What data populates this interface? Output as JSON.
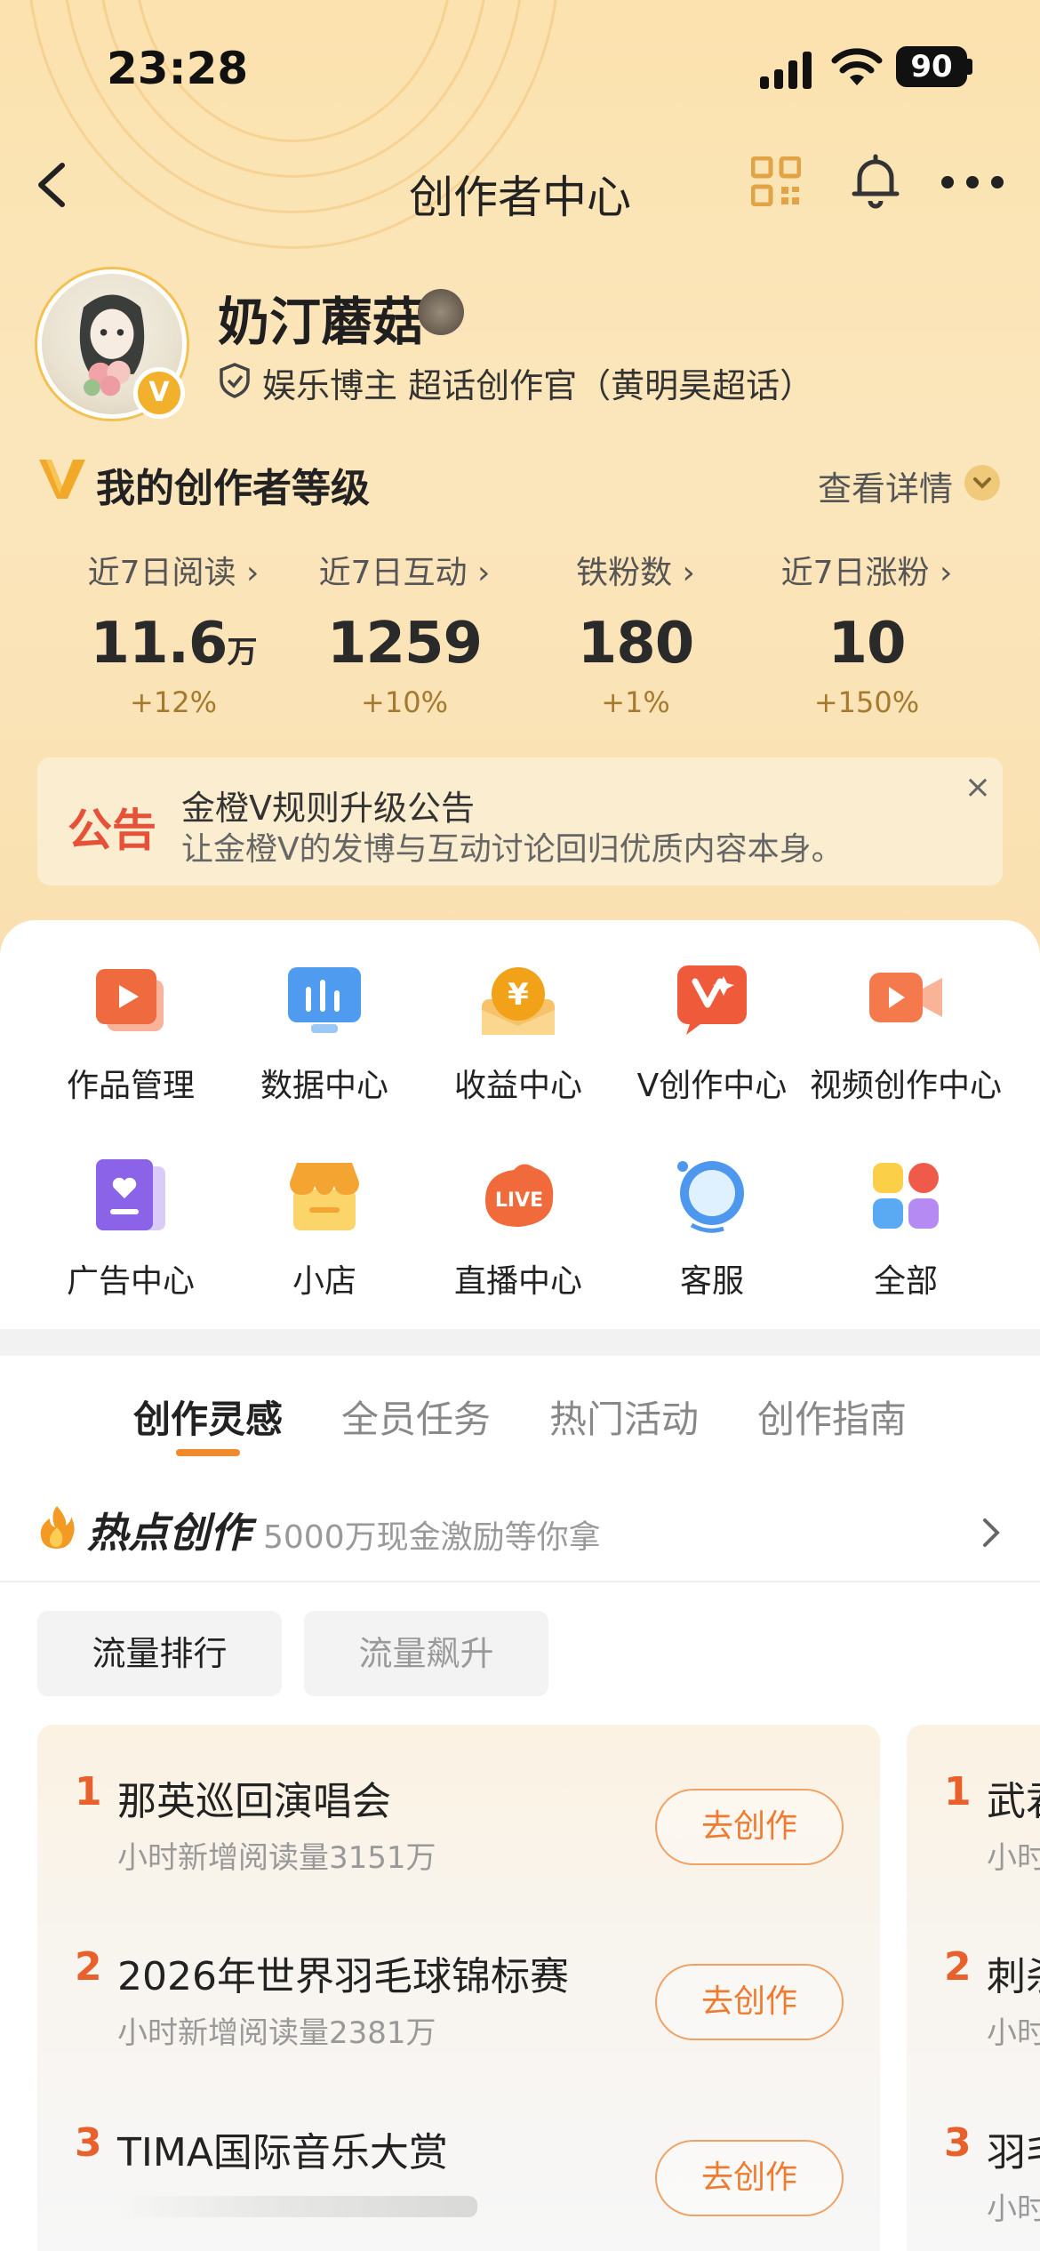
{
  "status_bar": {
    "time": "23:28",
    "battery": "90"
  },
  "nav": {
    "title": "创作者中心"
  },
  "profile": {
    "name": "奶汀蘑菇",
    "verified_badge": "V",
    "tags": "娱乐博主 超话创作官（黄明昊超话）"
  },
  "level": {
    "title": "我的创作者等级",
    "detail_link": "查看详情"
  },
  "stats": [
    {
      "label": "近7日阅读 ›",
      "value": "11.6",
      "unit": "万",
      "change": "+12%"
    },
    {
      "label": "近7日互动 ›",
      "value": "1259",
      "unit": "",
      "change": "+10%"
    },
    {
      "label": "铁粉数 ›",
      "value": "180",
      "unit": "",
      "change": "+1%"
    },
    {
      "label": "近7日涨粉 ›",
      "value": "10",
      "unit": "",
      "change": "+150%"
    }
  ],
  "notice": {
    "tag": "公告",
    "title": "金橙V规则升级公告",
    "subtitle": "让金橙V的发博与互动讨论回归优质内容本身。",
    "close": "×"
  },
  "tools": [
    {
      "label": "作品管理",
      "icon": "works-icon"
    },
    {
      "label": "数据中心",
      "icon": "data-icon"
    },
    {
      "label": "收益中心",
      "icon": "income-icon"
    },
    {
      "label": "V创作中心",
      "icon": "v-creation-icon"
    },
    {
      "label": "视频创作中心",
      "icon": "video-icon"
    },
    {
      "label": "广告中心",
      "icon": "ad-icon"
    },
    {
      "label": "小店",
      "icon": "shop-icon"
    },
    {
      "label": "直播中心",
      "icon": "live-icon"
    },
    {
      "label": "客服",
      "icon": "service-icon"
    },
    {
      "label": "全部",
      "icon": "all-icon"
    }
  ],
  "tabs": [
    "创作灵感",
    "全员任务",
    "热门活动",
    "创作指南"
  ],
  "hot": {
    "title": "热点创作",
    "subtitle": "5000万现金激励等你拿"
  },
  "chips": [
    "流量排行",
    "流量飙升"
  ],
  "ranking": [
    {
      "rank": "1",
      "title": "那英巡回演唱会",
      "sub": "小时新增阅读量3151万",
      "button": "去创作"
    },
    {
      "rank": "2",
      "title": "2026年世界羽毛球锦标赛",
      "sub": "小时新增阅读量2381万",
      "button": "去创作"
    },
    {
      "rank": "3",
      "title": "TIMA国际音乐大赏",
      "sub": "",
      "button": "去创作"
    }
  ],
  "ranking_second": [
    {
      "rank": "1",
      "title": "武君",
      "sub": "小时"
    },
    {
      "rank": "2",
      "title": "刺杀",
      "sub": "小时"
    },
    {
      "rank": "3",
      "title": "羽毛",
      "sub": "小时"
    }
  ],
  "colors": {
    "accent": "#f08a2b",
    "rank": "#e8612c",
    "header_bg": "#fbe2ae"
  }
}
